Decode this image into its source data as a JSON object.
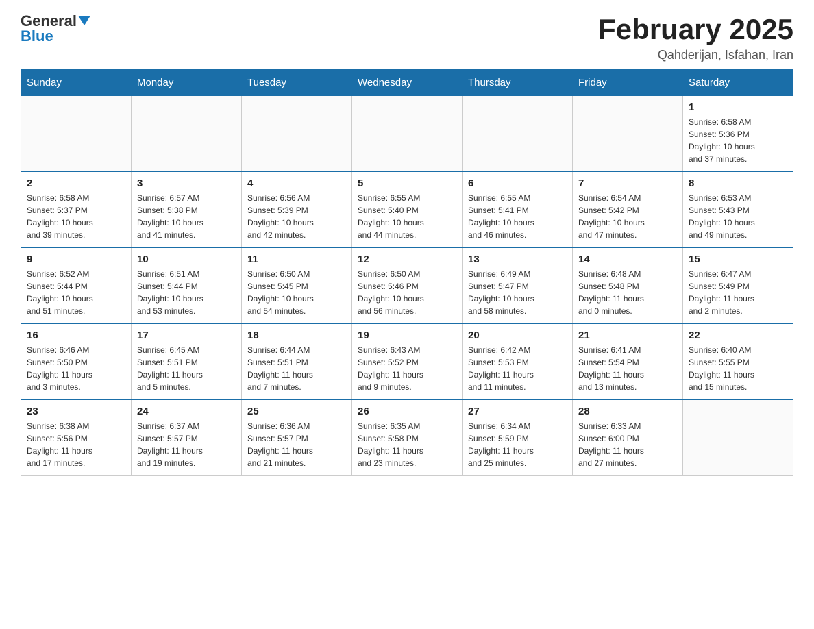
{
  "header": {
    "logo_general": "General",
    "logo_blue": "Blue",
    "month_title": "February 2025",
    "location": "Qahderijan, Isfahan, Iran"
  },
  "days_of_week": [
    "Sunday",
    "Monday",
    "Tuesday",
    "Wednesday",
    "Thursday",
    "Friday",
    "Saturday"
  ],
  "weeks": [
    [
      {
        "day": "",
        "info": ""
      },
      {
        "day": "",
        "info": ""
      },
      {
        "day": "",
        "info": ""
      },
      {
        "day": "",
        "info": ""
      },
      {
        "day": "",
        "info": ""
      },
      {
        "day": "",
        "info": ""
      },
      {
        "day": "1",
        "info": "Sunrise: 6:58 AM\nSunset: 5:36 PM\nDaylight: 10 hours\nand 37 minutes."
      }
    ],
    [
      {
        "day": "2",
        "info": "Sunrise: 6:58 AM\nSunset: 5:37 PM\nDaylight: 10 hours\nand 39 minutes."
      },
      {
        "day": "3",
        "info": "Sunrise: 6:57 AM\nSunset: 5:38 PM\nDaylight: 10 hours\nand 41 minutes."
      },
      {
        "day": "4",
        "info": "Sunrise: 6:56 AM\nSunset: 5:39 PM\nDaylight: 10 hours\nand 42 minutes."
      },
      {
        "day": "5",
        "info": "Sunrise: 6:55 AM\nSunset: 5:40 PM\nDaylight: 10 hours\nand 44 minutes."
      },
      {
        "day": "6",
        "info": "Sunrise: 6:55 AM\nSunset: 5:41 PM\nDaylight: 10 hours\nand 46 minutes."
      },
      {
        "day": "7",
        "info": "Sunrise: 6:54 AM\nSunset: 5:42 PM\nDaylight: 10 hours\nand 47 minutes."
      },
      {
        "day": "8",
        "info": "Sunrise: 6:53 AM\nSunset: 5:43 PM\nDaylight: 10 hours\nand 49 minutes."
      }
    ],
    [
      {
        "day": "9",
        "info": "Sunrise: 6:52 AM\nSunset: 5:44 PM\nDaylight: 10 hours\nand 51 minutes."
      },
      {
        "day": "10",
        "info": "Sunrise: 6:51 AM\nSunset: 5:44 PM\nDaylight: 10 hours\nand 53 minutes."
      },
      {
        "day": "11",
        "info": "Sunrise: 6:50 AM\nSunset: 5:45 PM\nDaylight: 10 hours\nand 54 minutes."
      },
      {
        "day": "12",
        "info": "Sunrise: 6:50 AM\nSunset: 5:46 PM\nDaylight: 10 hours\nand 56 minutes."
      },
      {
        "day": "13",
        "info": "Sunrise: 6:49 AM\nSunset: 5:47 PM\nDaylight: 10 hours\nand 58 minutes."
      },
      {
        "day": "14",
        "info": "Sunrise: 6:48 AM\nSunset: 5:48 PM\nDaylight: 11 hours\nand 0 minutes."
      },
      {
        "day": "15",
        "info": "Sunrise: 6:47 AM\nSunset: 5:49 PM\nDaylight: 11 hours\nand 2 minutes."
      }
    ],
    [
      {
        "day": "16",
        "info": "Sunrise: 6:46 AM\nSunset: 5:50 PM\nDaylight: 11 hours\nand 3 minutes."
      },
      {
        "day": "17",
        "info": "Sunrise: 6:45 AM\nSunset: 5:51 PM\nDaylight: 11 hours\nand 5 minutes."
      },
      {
        "day": "18",
        "info": "Sunrise: 6:44 AM\nSunset: 5:51 PM\nDaylight: 11 hours\nand 7 minutes."
      },
      {
        "day": "19",
        "info": "Sunrise: 6:43 AM\nSunset: 5:52 PM\nDaylight: 11 hours\nand 9 minutes."
      },
      {
        "day": "20",
        "info": "Sunrise: 6:42 AM\nSunset: 5:53 PM\nDaylight: 11 hours\nand 11 minutes."
      },
      {
        "day": "21",
        "info": "Sunrise: 6:41 AM\nSunset: 5:54 PM\nDaylight: 11 hours\nand 13 minutes."
      },
      {
        "day": "22",
        "info": "Sunrise: 6:40 AM\nSunset: 5:55 PM\nDaylight: 11 hours\nand 15 minutes."
      }
    ],
    [
      {
        "day": "23",
        "info": "Sunrise: 6:38 AM\nSunset: 5:56 PM\nDaylight: 11 hours\nand 17 minutes."
      },
      {
        "day": "24",
        "info": "Sunrise: 6:37 AM\nSunset: 5:57 PM\nDaylight: 11 hours\nand 19 minutes."
      },
      {
        "day": "25",
        "info": "Sunrise: 6:36 AM\nSunset: 5:57 PM\nDaylight: 11 hours\nand 21 minutes."
      },
      {
        "day": "26",
        "info": "Sunrise: 6:35 AM\nSunset: 5:58 PM\nDaylight: 11 hours\nand 23 minutes."
      },
      {
        "day": "27",
        "info": "Sunrise: 6:34 AM\nSunset: 5:59 PM\nDaylight: 11 hours\nand 25 minutes."
      },
      {
        "day": "28",
        "info": "Sunrise: 6:33 AM\nSunset: 6:00 PM\nDaylight: 11 hours\nand 27 minutes."
      },
      {
        "day": "",
        "info": ""
      }
    ]
  ]
}
